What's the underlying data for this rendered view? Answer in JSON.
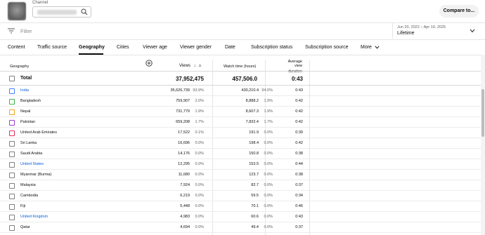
{
  "header": {
    "channel_label": "Channel",
    "compare_button": "Compare to..."
  },
  "filter": {
    "placeholder": "Filter",
    "date_range": "Jun 20, 2022 – Apr 19, 2025",
    "date_preset": "Lifetime"
  },
  "tabs": [
    {
      "label": "Content"
    },
    {
      "label": "Traffic source"
    },
    {
      "label": "Geography"
    },
    {
      "label": "Cities"
    },
    {
      "label": "Viewer age"
    },
    {
      "label": "Viewer gender"
    },
    {
      "label": "Date"
    },
    {
      "label": "Subscription status"
    },
    {
      "label": "Subscription source"
    },
    {
      "label": "More"
    }
  ],
  "table": {
    "columns": {
      "geography": "Geography",
      "views": "Views",
      "watch_time": "Watch time (hours)",
      "avd_line1": "Average view",
      "avd_line2": "duration"
    },
    "total": {
      "label": "Total",
      "views": "37,952,475",
      "watch_time": "457,506.0",
      "avd": "0:43"
    },
    "rows": [
      {
        "name": "India",
        "link": true,
        "checkbox_color": "#3e80ff",
        "views": "35,626,739",
        "views_pct": "93.9%",
        "watch": "430,210.4",
        "watch_pct": "94.0%",
        "avd": "0:43"
      },
      {
        "name": "Bangladesh",
        "link": false,
        "checkbox_color": "#39b54a",
        "views": "759,907",
        "views_pct": "2.0%",
        "watch": "8,888.2",
        "watch_pct": "1.9%",
        "avd": "0:42"
      },
      {
        "name": "Nepal",
        "link": false,
        "checkbox_color": "#f2a51a",
        "views": "731,779",
        "views_pct": "1.9%",
        "watch": "8,607.3",
        "watch_pct": "1.9%",
        "avd": "0:42"
      },
      {
        "name": "Pakistan",
        "link": false,
        "checkbox_color": "#9b3fd1",
        "views": "659,208",
        "views_pct": "1.7%",
        "watch": "7,832.4",
        "watch_pct": "1.7%",
        "avd": "0:42"
      },
      {
        "name": "United Arab Emirates",
        "link": false,
        "checkbox_color": "#e2325b",
        "views": "17,522",
        "views_pct": "0.1%",
        "watch": "191.9",
        "watch_pct": "0.0%",
        "avd": "0:39"
      },
      {
        "name": "Sri Lanka",
        "link": false,
        "checkbox_color": "#808080",
        "views": "16,696",
        "views_pct": "0.0%",
        "watch": "198.4",
        "watch_pct": "0.0%",
        "avd": "0:42"
      },
      {
        "name": "Saudi Arabia",
        "link": false,
        "checkbox_color": "#808080",
        "views": "14,176",
        "views_pct": "0.0%",
        "watch": "150.8",
        "watch_pct": "0.0%",
        "avd": "0:38"
      },
      {
        "name": "United States",
        "link": true,
        "checkbox_color": "#808080",
        "views": "12,295",
        "views_pct": "0.0%",
        "watch": "153.5",
        "watch_pct": "0.0%",
        "avd": "0:44"
      },
      {
        "name": "Myanmar (Burma)",
        "link": false,
        "checkbox_color": "#808080",
        "views": "11,680",
        "views_pct": "0.0%",
        "watch": "123.7",
        "watch_pct": "0.0%",
        "avd": "0:38"
      },
      {
        "name": "Malaysia",
        "link": false,
        "checkbox_color": "#808080",
        "views": "7,924",
        "views_pct": "0.0%",
        "watch": "82.7",
        "watch_pct": "0.0%",
        "avd": "0:37"
      },
      {
        "name": "Cambodia",
        "link": false,
        "checkbox_color": "#808080",
        "views": "6,219",
        "views_pct": "0.0%",
        "watch": "59.5",
        "watch_pct": "0.0%",
        "avd": "0:34"
      },
      {
        "name": "Fiji",
        "link": false,
        "checkbox_color": "#808080",
        "views": "5,448",
        "views_pct": "0.0%",
        "watch": "70.1",
        "watch_pct": "0.0%",
        "avd": "0:46"
      },
      {
        "name": "United Kingdom",
        "link": true,
        "checkbox_color": "#808080",
        "views": "4,983",
        "views_pct": "0.0%",
        "watch": "60.6",
        "watch_pct": "0.0%",
        "avd": "0:43"
      },
      {
        "name": "Qatar",
        "link": false,
        "checkbox_color": "#808080",
        "views": "4,694",
        "views_pct": "0.0%",
        "watch": "49.4",
        "watch_pct": "0.0%",
        "avd": "0:37"
      }
    ]
  },
  "colors": {
    "link": "#065fd4",
    "accent_text": "#0d0d0d"
  }
}
